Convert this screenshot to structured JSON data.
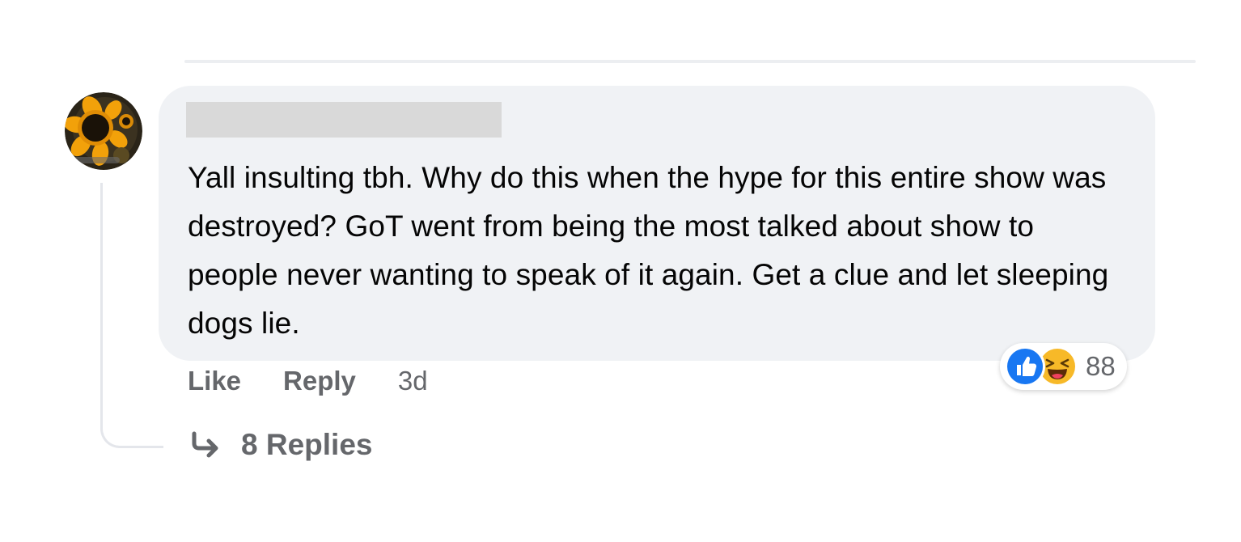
{
  "comment": {
    "author_redacted": true,
    "text": "Yall insulting tbh. Why do this when the hype for this entire show was destroyed? GoT went from being the most talked about show to people never wanting to speak of it again. Get a clue and let sleeping dogs lie.",
    "avatar_icon": "sunflower-avatar-icon"
  },
  "reactions": {
    "icons": [
      "like-reaction-icon",
      "haha-reaction-icon"
    ],
    "count": "88",
    "like_color": "#1877f2",
    "haha_color": "#f7b928"
  },
  "actions": {
    "like_label": "Like",
    "reply_label": "Reply",
    "timestamp": "3d"
  },
  "replies": {
    "label": "8 Replies",
    "icon": "reply-arrow-icon"
  },
  "colors": {
    "bubble_bg": "#f0f2f5",
    "secondary_text": "#65676b",
    "primary_text": "#050505"
  }
}
